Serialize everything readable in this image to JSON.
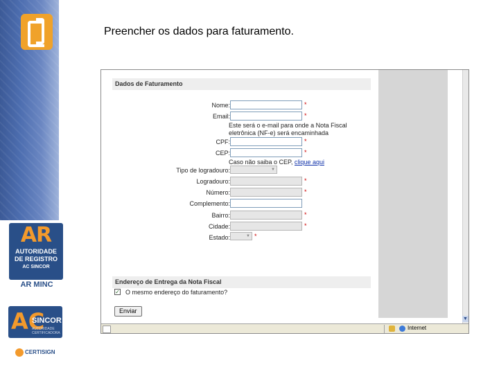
{
  "slide": {
    "title": "Preencher os dados para faturamento."
  },
  "brand": {
    "ar_letters": "AR",
    "ar_line1": "AUTORIDADE",
    "ar_line2": "DE REGISTRO",
    "ar_line3": "AC SINCOR",
    "ar_minc": "AR MINC",
    "ac_letters": "AC",
    "ac_name": "SINCOR",
    "ac_sub": "AUTORIDADE CERTIFICADORA",
    "certisign": "CERTISIGN",
    "accent_color": "#f39a2c",
    "brand_color": "#294f88"
  },
  "form": {
    "section1_title": "Dados de Faturamento",
    "fields": {
      "nome": "Nome:",
      "email": "Email:",
      "email_note1": "Este será o e-mail para onde a Nota Fiscal",
      "email_note2": "eletrônica (NF-e) será encaminhada",
      "cpf": "CPF:",
      "cep": "CEP:",
      "cep_note": "Caso não saiba o CEP,",
      "cep_link": "clique aqui",
      "tipo_logradouro": "Tipo de logradouro:",
      "logradouro": "Logradouro:",
      "numero": "Número:",
      "complemento": "Complemento:",
      "bairro": "Bairro:",
      "cidade": "Cidade:",
      "estado": "Estado:"
    },
    "required_mark": "*",
    "section2_title": "Endereço de Entrega da Nota Fiscal",
    "same_address_label": "O mesmo endereço do faturamento?",
    "same_address_checked": true,
    "submit_label": "Enviar"
  },
  "status_bar": {
    "zone": "Internet"
  }
}
